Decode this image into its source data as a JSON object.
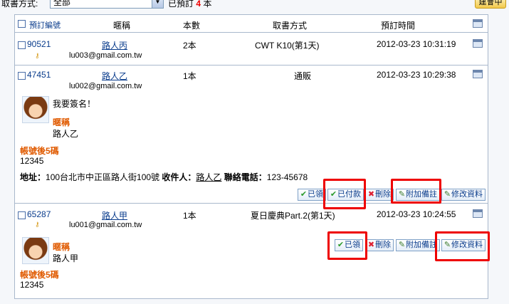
{
  "toolbar": {
    "filter_label": "取書方式:",
    "filter_value": "全部",
    "reserved_prefix": "已預訂",
    "reserved_count": "4",
    "reserved_suffix": "本",
    "create_label": "建會中"
  },
  "columns": {
    "id": "預訂編號",
    "nickname": "暱稱",
    "qty": "本數",
    "method": "取書方式",
    "time": "預訂時間"
  },
  "rows": [
    {
      "id": "90521",
      "nickname": "路人丙",
      "qty": "2本",
      "method": "CWT K10(第1天)",
      "time": "2012-03-23 10:31:19",
      "email": "lu003@gmail.com.tw"
    },
    {
      "id": "47451",
      "nickname": "路人乙",
      "qty": "1本",
      "method": "通販",
      "time": "2012-03-23 10:29:38",
      "email": "lu002@gmail.com.tw",
      "message": "我要簽名！",
      "nick_label": "暱稱",
      "nick_value": "路人乙",
      "acct_label": "帳號後5碼",
      "acct_value": "12345",
      "addr_label": "地址：",
      "addr_value": "100台北市中正區路人街100號",
      "recv_label": "收件人：",
      "recv_value": "路人乙",
      "phone_label": "聯絡電話：",
      "phone_value": "123-45678",
      "actions": {
        "done": "已領",
        "paid": "已付款",
        "delete": "刪除",
        "note": "附加備註",
        "edit": "修改資料"
      }
    },
    {
      "id": "65287",
      "nickname": "路人甲",
      "qty": "1本",
      "method": "夏日慶典Part.2(第1天)",
      "time": "2012-03-23 10:24:55",
      "email": "lu001@gmail.com.tw",
      "nick_label": "暱稱",
      "nick_value": "路人甲",
      "acct_label": "帳號後5碼",
      "acct_value": "12345",
      "actions": {
        "done": "已領",
        "delete": "刪除",
        "note": "附加備註",
        "edit": "修改資料"
      }
    }
  ],
  "colors": {
    "highlight": "#e00000",
    "label_orange": "#e05a00",
    "link": "#0a3c8c"
  }
}
